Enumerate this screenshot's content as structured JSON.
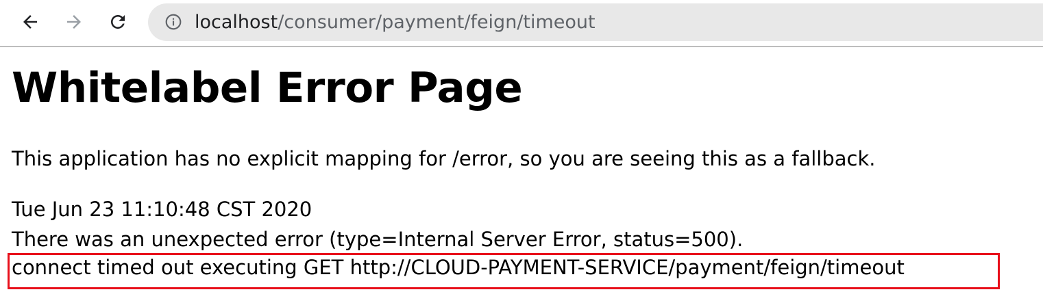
{
  "browser": {
    "back_icon": "arrow-left-icon",
    "forward_icon": "arrow-right-icon",
    "reload_icon": "reload-icon",
    "info_icon": "info-circle-icon",
    "url_host": "localhost",
    "url_path": "/consumer/payment/feign/timeout"
  },
  "page": {
    "title": "Whitelabel Error Page",
    "lead": "This application has no explicit mapping for /error, so you are seeing this as a fallback.",
    "timestamp": "Tue Jun 23 11:10:48 CST 2020",
    "error_summary": "There was an unexpected error (type=Internal Server Error, status=500).",
    "error_message": "connect timed out executing GET http://CLOUD-PAYMENT-SERVICE/payment/feign/timeout"
  },
  "colors": {
    "highlight_border": "#e8101b",
    "omnibox_bg": "#e8e8e8"
  }
}
